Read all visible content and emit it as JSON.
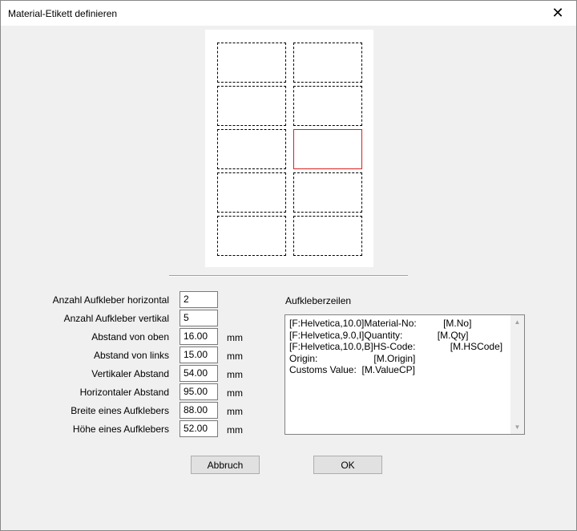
{
  "window": {
    "title": "Material-Etikett definieren",
    "close_glyph": "✕"
  },
  "preview": {
    "columns": 2,
    "rows": 5,
    "selected": {
      "row": 3,
      "col": 2
    }
  },
  "form": {
    "rows": [
      {
        "label": "Anzahl Aufkleber horizontal",
        "value": "2",
        "unit": ""
      },
      {
        "label": "Anzahl Aufkleber vertikal",
        "value": "5",
        "unit": ""
      },
      {
        "label": "Abstand von oben",
        "value": "16.00",
        "unit": "mm"
      },
      {
        "label": "Abstand von links",
        "value": "15.00",
        "unit": "mm"
      },
      {
        "label": "Vertikaler Abstand",
        "value": "54.00",
        "unit": "mm"
      },
      {
        "label": "Horizontaler Abstand",
        "value": "95.00",
        "unit": "mm"
      },
      {
        "label": "Breite eines Aufklebers",
        "value": "88.00",
        "unit": "mm"
      },
      {
        "label": "Höhe eines Aufklebers",
        "value": "52.00",
        "unit": "mm"
      }
    ]
  },
  "lines": {
    "label": "Aufkleberzeilen",
    "text": "[F:Helvetica,10.0]Material-No:          [M.No]\n[F:Helvetica,9.0,I]Quantity:             [M.Qty]\n[F:Helvetica,10.0,B]HS-Code:             [M.HSCode]\nOrigin:                     [M.Origin]\nCustoms Value:  [M.ValueCP]"
  },
  "buttons": {
    "cancel": "Abbruch",
    "ok": "OK"
  }
}
